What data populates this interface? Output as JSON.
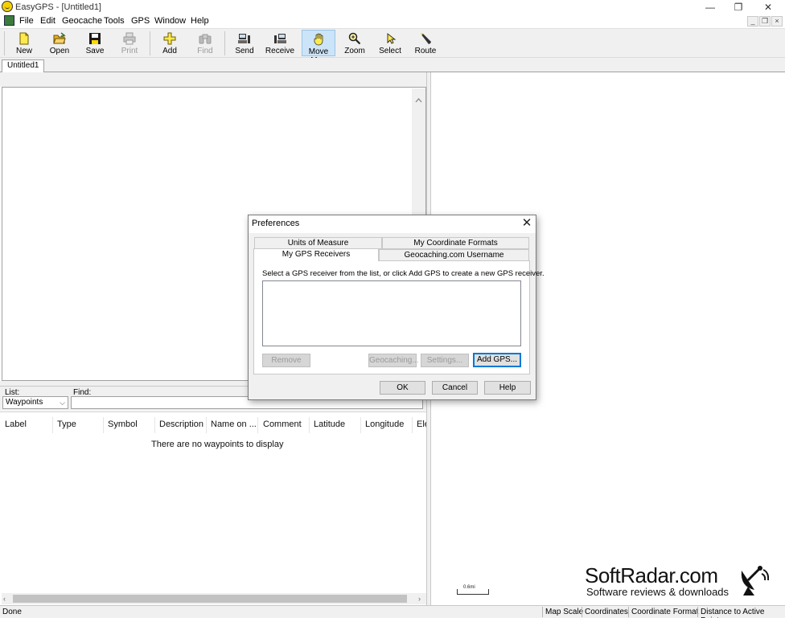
{
  "window": {
    "title": "EasyGPS - [Untitled1]",
    "minimize": "—",
    "restore": "❐",
    "close": "✕",
    "mdi_min": "_",
    "mdi_restore": "❐",
    "mdi_close": "×"
  },
  "menu": [
    "File",
    "Edit",
    "Geocache",
    "Tools",
    "GPS",
    "Window",
    "Help"
  ],
  "toolbar": {
    "new": "New",
    "open": "Open",
    "save": "Save",
    "print": "Print",
    "add": "Add",
    "find": "Find",
    "send": "Send",
    "receive": "Receive",
    "move_map": "Move Map",
    "zoom": "Zoom",
    "select": "Select",
    "route": "Route"
  },
  "doc_tab": "Untitled1",
  "list_panel": {
    "list_label": "List:",
    "find_label": "Find:",
    "list_value": "Waypoints",
    "find_value": "",
    "columns": [
      "Label",
      "Type",
      "Symbol",
      "Description",
      "Name on ...",
      "Comment",
      "Latitude",
      "Longitude",
      "Ele"
    ],
    "empty_message": "There are no waypoints to display"
  },
  "status": {
    "text": "Done",
    "panes": [
      "Map Scale",
      "Coordinates",
      "Coordinate Format",
      "Distance to Active Point"
    ]
  },
  "map": {
    "scale_label": "0.6mi"
  },
  "watermark": {
    "title": "SoftRadar.com",
    "subtitle": "Software reviews & downloads"
  },
  "dialog": {
    "title": "Preferences",
    "close": "✕",
    "tabs_row1": [
      "Units of Measure",
      "My Coordinate Formats"
    ],
    "tabs_row2": [
      "My GPS Receivers",
      "Geocaching.com Username"
    ],
    "instruction": "Select a GPS receiver from the list, or click Add GPS to create a new GPS receiver.",
    "buttons": {
      "remove": "Remove",
      "geocaching": "Geocaching...",
      "settings": "Settings...",
      "add_gps": "Add GPS...",
      "ok": "OK",
      "cancel": "Cancel",
      "help": "Help"
    }
  }
}
